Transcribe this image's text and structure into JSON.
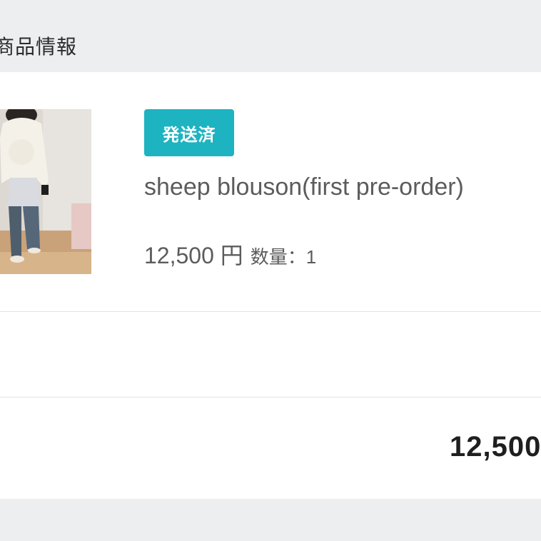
{
  "section": {
    "title": "商品情報"
  },
  "item": {
    "status_badge": "発送済",
    "name": "sheep blouson(first pre-order)",
    "price": "12,500 円",
    "quantity": "数量：1",
    "thumbnail_icon": "product-photo"
  },
  "summary": {
    "total": "12,500"
  },
  "colors": {
    "badge": "#1db3c1",
    "background": "#eceeef",
    "card": "#ffffff"
  }
}
